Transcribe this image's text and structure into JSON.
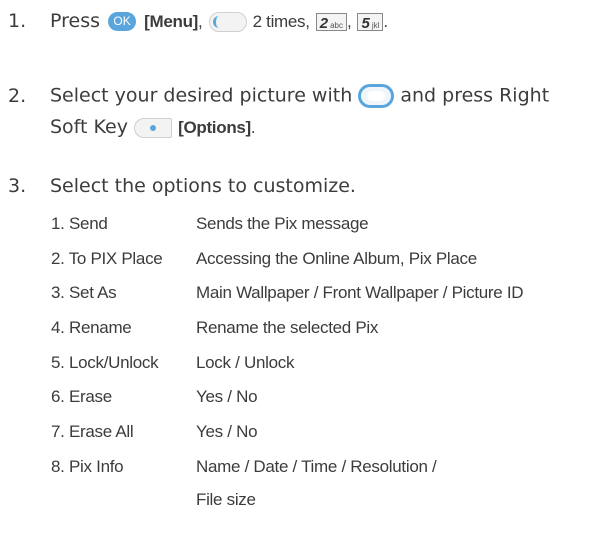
{
  "steps": [
    {
      "number": "1.",
      "press": "Press",
      "ok_icon": "OK",
      "menu_label": "[Menu]",
      "comma1": ",",
      "times": "2 times,",
      "key2_digit": "2",
      "key2_letters": "abc",
      "comma2": ",",
      "key5_digit": "5",
      "key5_letters": "jkl",
      "period": "."
    },
    {
      "number": "2.",
      "text_before": "Select your desired picture with",
      "text_after": "and press Right",
      "line2_before": "Soft Key",
      "options_label": "[Options]",
      "period": "."
    },
    {
      "number": "3.",
      "text": "Select the options to customize."
    }
  ],
  "options": [
    {
      "label": "1. Send",
      "description": "Sends the Pix message"
    },
    {
      "label": "2. To PIX Place",
      "description": "Accessing the Online Album, Pix Place"
    },
    {
      "label": "3. Set As",
      "description": "Main Wallpaper / Front Wallpaper / Picture ID"
    },
    {
      "label": "4. Rename",
      "description": "Rename the selected Pix"
    },
    {
      "label": "5. Lock/Unlock",
      "description": "Lock / Unlock"
    },
    {
      "label": "6. Erase",
      "description": "Yes / No"
    },
    {
      "label": "7. Erase All",
      "description": "Yes / No"
    },
    {
      "label": "8. Pix Info",
      "description": "Name / Date / Time / Resolution /",
      "description_line2": "File size"
    }
  ],
  "icons": [
    "ok-key-icon",
    "nav-left-key-icon",
    "key-2-icon",
    "key-5-icon",
    "nav-ring-key-icon",
    "right-soft-key-icon"
  ],
  "colors": {
    "accent": "#5aa6dc",
    "text": "#3c3c3c"
  }
}
